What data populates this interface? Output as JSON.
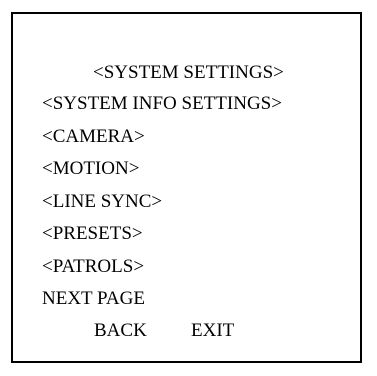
{
  "osd_menu": {
    "title": "<SYSTEM SETTINGS>",
    "items": [
      "<SYSTEM INFO SETTINGS>",
      "<CAMERA>",
      "<MOTION>",
      "<LINE SYNC>",
      "<PRESETS>",
      "<PATROLS>",
      "NEXT PAGE"
    ],
    "back_label": "BACK",
    "exit_label": "EXIT"
  }
}
